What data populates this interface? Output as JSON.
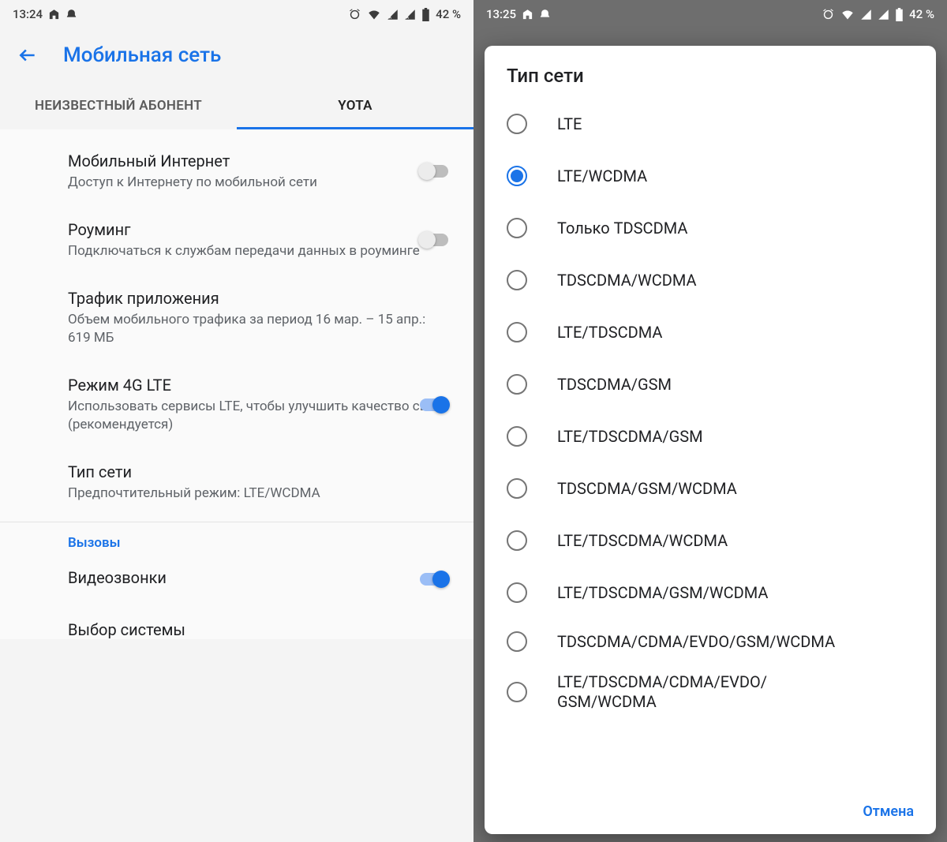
{
  "left": {
    "status": {
      "time": "13:24",
      "battery": "42 %"
    },
    "header": {
      "title": "Мобильная сеть"
    },
    "tabs": {
      "inactive": "НЕИЗВЕСТНЫЙ АБОНЕНТ",
      "active": "YOTA"
    },
    "settings": {
      "mobile_data": {
        "title": "Мобильный Интернет",
        "sub": "Доступ к Интернету по мобильной сети"
      },
      "roaming": {
        "title": "Роуминг",
        "sub": "Подключаться к службам передачи данных в роуминге"
      },
      "traffic": {
        "title": "Трафик приложения",
        "sub": "Объем мобильного трафика за период 16 мар. – 15 апр.: 619 МБ"
      },
      "lte4g": {
        "title": "Режим 4G LTE",
        "sub": "Использовать сервисы LTE, чтобы улучшить качество связи (рекомендуется)"
      },
      "net_type": {
        "title": "Тип сети",
        "sub": "Предпочтительный режим: LTE/WCDMA"
      },
      "calls_section": "Вызовы",
      "video_calls": {
        "title": "Видеозвонки"
      },
      "system_select": {
        "title": "Выбор системы"
      }
    }
  },
  "right": {
    "status": {
      "time": "13:25",
      "battery": "42 %"
    },
    "dialog": {
      "title": "Тип сети",
      "options": [
        "LTE",
        "LTE/WCDMA",
        "Только TDSCDMA",
        "TDSCDMA/WCDMA",
        "LTE/TDSCDMA",
        "TDSCDMA/GSM",
        "LTE/TDSCDMA/GSM",
        "TDSCDMA/GSM/WCDMA",
        "LTE/TDSCDMA/WCDMA",
        "LTE/TDSCDMA/GSM/WCDMA",
        "TDSCDMA/CDMA/EVDO/GSM/WCDMA",
        "LTE/TDSCDMA/CDMA/EVDO/GSM/WCDMA"
      ],
      "selected_index": 1,
      "cancel": "Отмена"
    }
  }
}
